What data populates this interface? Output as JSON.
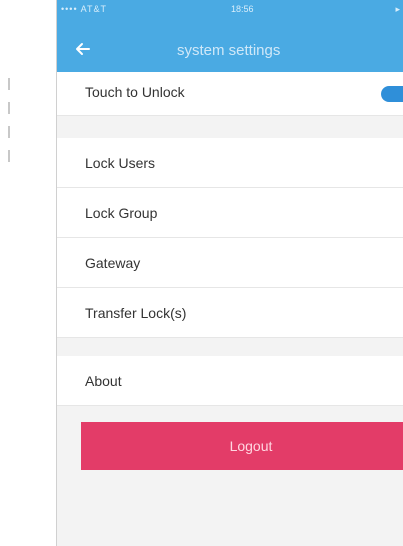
{
  "status_bar": {
    "carrier": "•••• AT&T",
    "time": "18:56",
    "battery": "▸"
  },
  "header": {
    "title": "system settings"
  },
  "settings": {
    "touch_unlock": {
      "label": "Touch to Unlock",
      "enabled": true
    },
    "items": [
      {
        "label": "Lock Users"
      },
      {
        "label": "Lock Group"
      },
      {
        "label": "Gateway"
      },
      {
        "label": "Transfer Lock(s)"
      }
    ],
    "about": {
      "label": "About"
    }
  },
  "actions": {
    "logout_label": "Logout"
  },
  "colors": {
    "header": "#4aaae3",
    "toggle_on": "#2f8fd9",
    "logout": "#e33c68",
    "background": "#f3f3f3"
  },
  "icons": {
    "back": "arrow-left-icon",
    "toggle": "toggle-switch"
  }
}
